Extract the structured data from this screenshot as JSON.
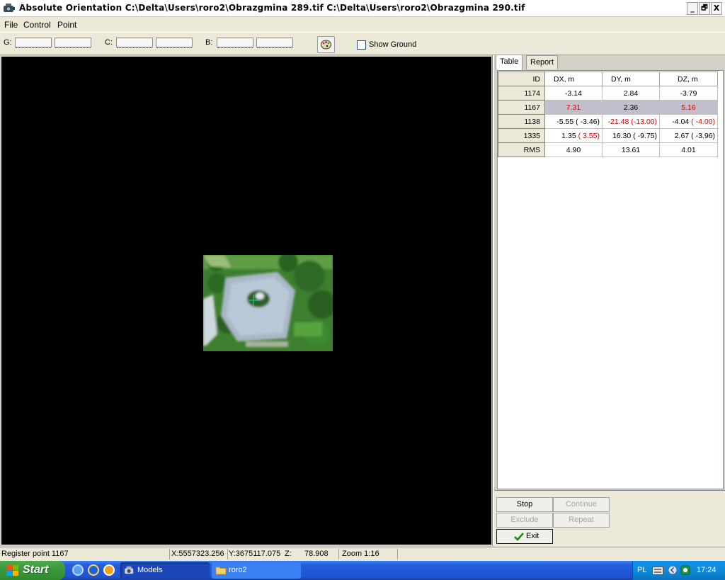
{
  "window": {
    "title": "Absolute Orientation  C:\\Delta\\Users\\roro2\\Obrazgmina 289.tif C:\\Delta\\Users\\roro2\\Obrazgmina 290.tif",
    "minimize": "_",
    "restore": "🗗",
    "close": "X"
  },
  "menu": {
    "file": "File",
    "control": "Control",
    "point": "Point"
  },
  "toolbar": {
    "g_label": "G:",
    "c_label": "C:",
    "b_label": "B:",
    "palette_icon": "palette-icon",
    "show_ground": "Show Ground",
    "show_ground_checked": false
  },
  "tabs": {
    "table": "Table",
    "report": "Report",
    "active": "table"
  },
  "table": {
    "headers": {
      "id": "ID",
      "dx": "DX, m",
      "dy": "DY, m",
      "dz": "DZ, m"
    },
    "rows": [
      {
        "id": "1174",
        "dx": "-3.14",
        "dy": "2.84",
        "dz": "-3.79",
        "dx_paren": "",
        "dy_paren": "",
        "dz_paren": ""
      },
      {
        "id": "1167",
        "dx": "7.31",
        "dy": "2.36",
        "dz": "5.16",
        "dx_paren": "",
        "dy_paren": "",
        "dz_paren": ""
      },
      {
        "id": "1138",
        "dx": "-5.55",
        "dy": "-21.48",
        "dz": "-4.04",
        "dx_paren": "( -3.46)",
        "dy_paren": "(-13.00)",
        "dz_paren": "( -4.00)"
      },
      {
        "id": "1335",
        "dx": "1.35",
        "dy": "16.30",
        "dz": "2.67",
        "dx_paren": "( 3.55)",
        "dy_paren": "( -9.75)",
        "dz_paren": "( -3.96)"
      },
      {
        "id": "RMS",
        "dx": "4.90",
        "dy": "13.61",
        "dz": "4.01",
        "dx_paren": "",
        "dy_paren": "",
        "dz_paren": ""
      }
    ],
    "selected_row": "1167",
    "highlight_color": "#d80000"
  },
  "buttons": {
    "stop": "Stop",
    "continue": "Continue",
    "exclude": "Exclude",
    "repeat": "Repeat",
    "exit": "Exit"
  },
  "status": {
    "message": "Register point 1167",
    "x": "X:5557323.256",
    "y": "Y:3675117.075",
    "z_label": "Z:",
    "z": "78.908",
    "zoom": "Zoom 1:16"
  },
  "taskbar": {
    "start": "Start",
    "task_models": "Models",
    "task_roro2": "roro2",
    "lang": "PL",
    "time": "17:24"
  }
}
